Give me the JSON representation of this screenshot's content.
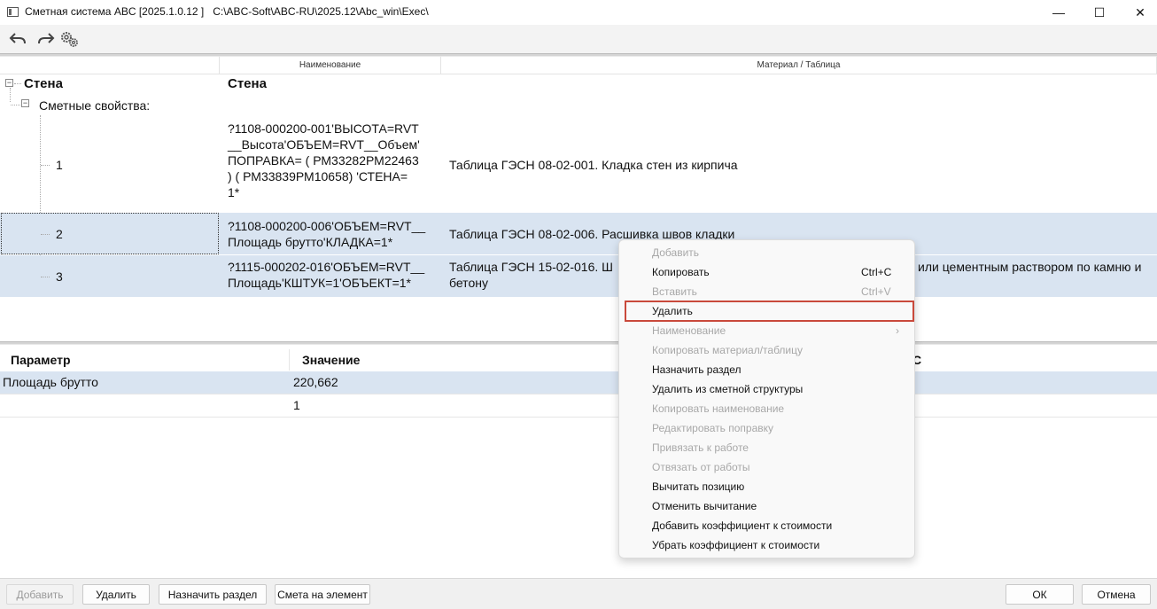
{
  "window": {
    "title": "Сметная система ABC [2025.1.0.12 ]   C:\\ABC-Soft\\ABC-RU\\2025.12\\Abc_win\\Exec\\",
    "minimize": "—",
    "maximize": "☐",
    "close": "✕"
  },
  "toolbar": {
    "undo_icon": "undo-arrow",
    "redo_icon": "redo-arrow",
    "settings_icon": "gears"
  },
  "tree": {
    "columns": [
      "Наименование",
      "Материал / Таблица"
    ],
    "root": {
      "label": "Стена",
      "name": "Стена"
    },
    "group": {
      "label": "Сметные свойства:"
    },
    "items": [
      {
        "num": "1",
        "name": [
          "?1108-000200-001'ВЫСОТА=RVT",
          "__Высота'ОБЪЕМ=RVT__Объем'",
          "ПОПРАВКА= ( РМ33282РМ22463",
          ")   ( РМ33839РМ10658)  'СТЕНА=",
          "1*"
        ],
        "material": "Таблица ГЭСН 08-02-001. Кладка стен из кирпича"
      },
      {
        "num": "2",
        "name": [
          "?1108-000200-006'ОБЪЕМ=RVT__",
          "Площадь брутто'КЛАДКА=1*"
        ],
        "material": "Таблица ГЭСН 08-02-006. Расшивка швов кладки"
      },
      {
        "num": "3",
        "name": [
          "?1115-000202-016'ОБЪЕМ=RVT__",
          "Площадь'КШТУК=1'ОБЪЕКТ=1*"
        ],
        "material": [
          "Таблица ГЭСН 15-02-016. Ш",
          "бетону"
        ],
        "material_tail": "или цементным раствором по камню и"
      }
    ]
  },
  "params": {
    "headers": [
      "Параметр",
      "Значение",
      "С"
    ],
    "rows": [
      {
        "param": "Площадь брутто",
        "value": "220,662"
      },
      {
        "param": "",
        "value": "1"
      }
    ]
  },
  "context_menu": {
    "items": [
      {
        "label": "Добавить",
        "shortcut": "",
        "disabled": true
      },
      {
        "label": "Копировать",
        "shortcut": "Ctrl+C",
        "disabled": false
      },
      {
        "label": "Вставить",
        "shortcut": "Ctrl+V",
        "disabled": true
      },
      {
        "label": "Удалить",
        "shortcut": "",
        "disabled": false
      },
      {
        "label": "Наименование",
        "shortcut": "›",
        "disabled": true
      },
      {
        "label": "Копировать материал/таблицу",
        "shortcut": "",
        "disabled": true
      },
      {
        "label": "Назначить раздел",
        "shortcut": "",
        "disabled": false
      },
      {
        "label": "Удалить из сметной структуры",
        "shortcut": "",
        "disabled": false
      },
      {
        "label": "Копировать наименование",
        "shortcut": "",
        "disabled": true
      },
      {
        "label": "Редактировать поправку",
        "shortcut": "",
        "disabled": true
      },
      {
        "label": "Привязать к работе",
        "shortcut": "",
        "disabled": true
      },
      {
        "label": "Отвязать от работы",
        "shortcut": "",
        "disabled": true
      },
      {
        "label": "Вычитать позицию",
        "shortcut": "",
        "disabled": false
      },
      {
        "label": "Отменить вычитание",
        "shortcut": "",
        "disabled": false
      },
      {
        "label": "Добавить коэффициент к стоимости",
        "shortcut": "",
        "disabled": false
      },
      {
        "label": "Убрать коэффициент к стоимости",
        "shortcut": "",
        "disabled": false
      }
    ]
  },
  "buttons": {
    "add": "Добавить",
    "delete": "Удалить",
    "assign_section": "Назначить раздел",
    "estimate_for_element": "Смета на элемент",
    "ok": "ОК",
    "cancel": "Отмена"
  },
  "colors": {
    "selected_row": "#d9e4f1",
    "highlight_border": "#c9493b"
  }
}
